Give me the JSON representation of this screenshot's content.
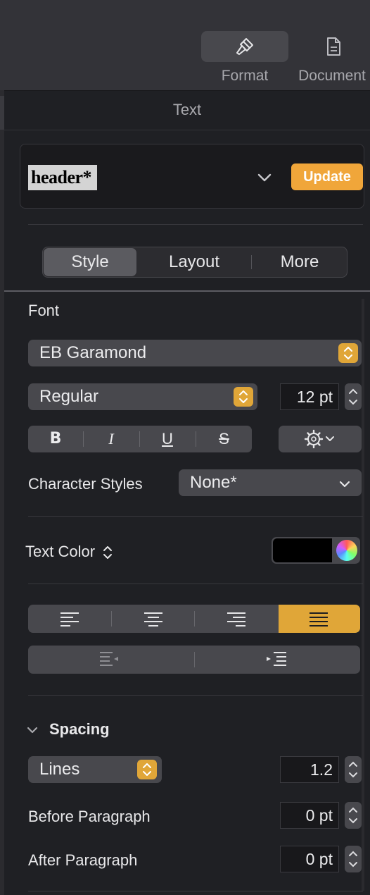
{
  "toolbar": {
    "format_label": "Format",
    "document_label": "Document"
  },
  "panel": {
    "title": "Text"
  },
  "paragraph_style": {
    "preview_text": "header*",
    "update_label": "Update"
  },
  "tabs": [
    {
      "label": "Style",
      "active": true
    },
    {
      "label": "Layout",
      "active": false
    },
    {
      "label": "More",
      "active": false
    }
  ],
  "font": {
    "section_label": "Font",
    "family": "EB Garamond",
    "typeface": "Regular",
    "size": "12 pt",
    "bold_label": "B",
    "italic_label": "I",
    "underline_label": "U",
    "strike_label": "S",
    "character_styles_label": "Character Styles",
    "character_styles_value": "None*"
  },
  "text_color": {
    "label": "Text Color",
    "value": "#000000"
  },
  "alignment": {
    "selected": "justify",
    "accent": "#e0a638"
  },
  "spacing": {
    "section_label": "Spacing",
    "line_mode": "Lines",
    "line_value": "1.2",
    "before_label": "Before Paragraph",
    "before_value": "0 pt",
    "after_label": "After Paragraph",
    "after_value": "0 pt"
  }
}
